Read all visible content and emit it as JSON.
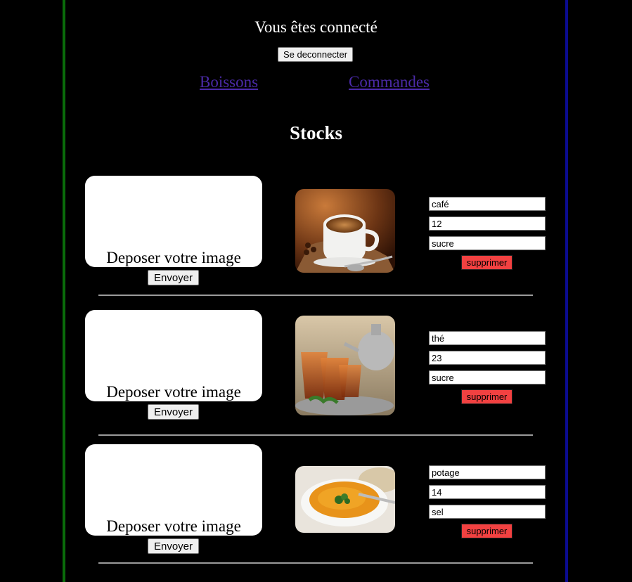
{
  "header": {
    "status_text": "Vous êtes connecté",
    "logout_label": "Se deconnecter"
  },
  "nav": {
    "links": [
      {
        "label": "Boissons"
      },
      {
        "label": "Commandes"
      }
    ]
  },
  "page_title": "Stocks",
  "upload": {
    "drop_label": "Deposer votre image",
    "send_label": "Envoyer"
  },
  "colors": {
    "left_border": "#0a6b0a",
    "right_border": "#0b0b8f",
    "link": "#4b2aa8",
    "delete_button": "#f24141"
  },
  "items": [
    {
      "name": "café",
      "quantity": "12",
      "ingredient": "sucre",
      "delete_label": "supprimer",
      "image": "coffee-cup-image"
    },
    {
      "name": "thé",
      "quantity": "23",
      "ingredient": "sucre",
      "delete_label": "supprimer",
      "image": "mint-tea-image"
    },
    {
      "name": "potage",
      "quantity": "14",
      "ingredient": "sel",
      "delete_label": "supprimer",
      "image": "soup-bowl-image"
    }
  ]
}
